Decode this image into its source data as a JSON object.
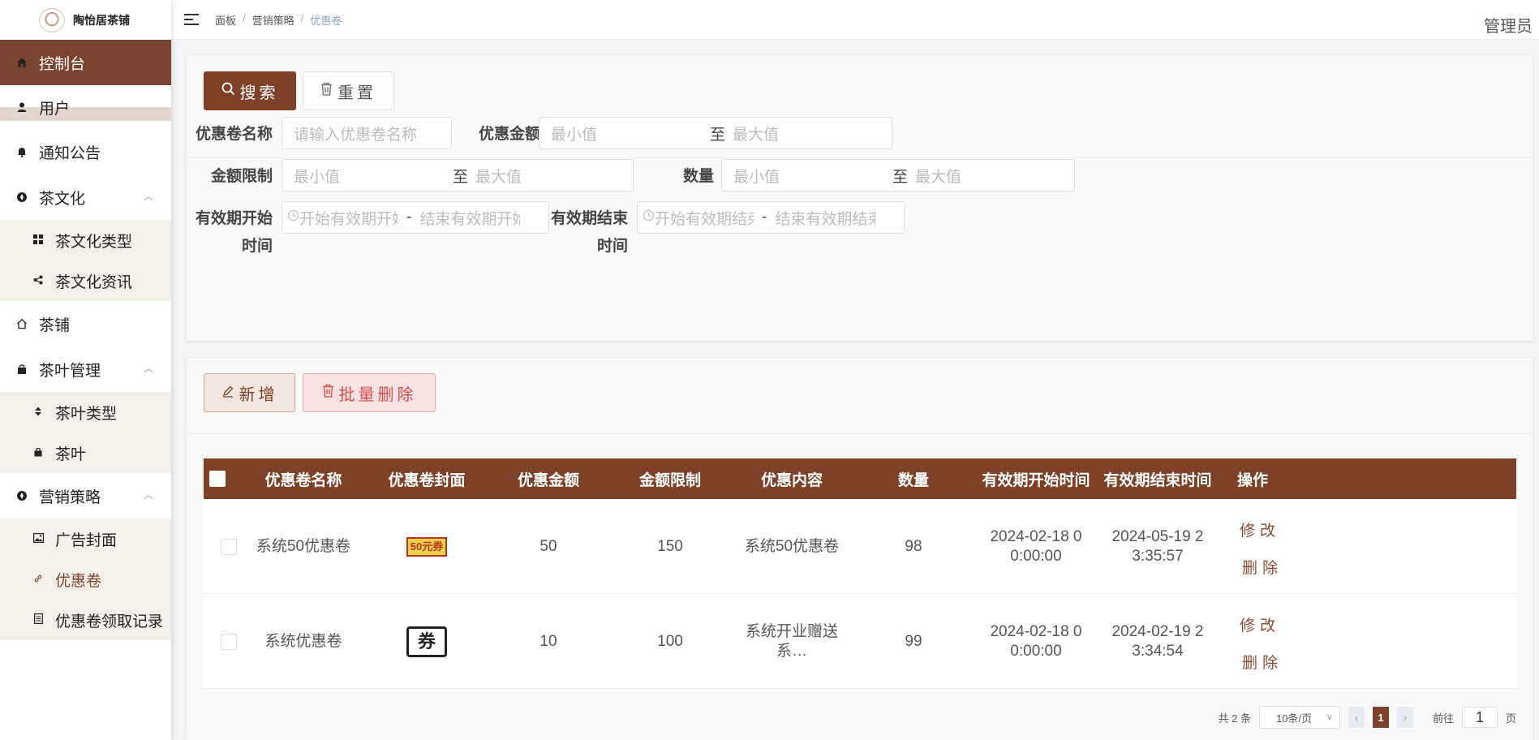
{
  "brand": {
    "name": "陶怡居茶铺"
  },
  "sidebar": {
    "items": [
      {
        "label": "控制台",
        "icon": "home-icon"
      },
      {
        "label": "用户",
        "icon": "user-icon"
      },
      {
        "label": "通知公告",
        "icon": "bell-icon"
      },
      {
        "label": "茶文化",
        "icon": "compass-icon",
        "children": [
          {
            "label": "茶文化类型",
            "icon": "grid-icon"
          },
          {
            "label": "茶文化资讯",
            "icon": "share-icon"
          }
        ]
      },
      {
        "label": "茶铺",
        "icon": "house-outline-icon"
      },
      {
        "label": "茶叶管理",
        "icon": "bag-icon",
        "children": [
          {
            "label": "茶叶类型",
            "icon": "sort-icon"
          },
          {
            "label": "茶叶",
            "icon": "bag-icon"
          }
        ]
      },
      {
        "label": "营销策略",
        "icon": "compass-icon",
        "children": [
          {
            "label": "广告封面",
            "icon": "picture-icon"
          },
          {
            "label": "优惠卷",
            "icon": "link-icon"
          },
          {
            "label": "优惠卷领取记录",
            "icon": "document-icon"
          }
        ]
      }
    ]
  },
  "header": {
    "breadcrumb": [
      "面板",
      "营销策略",
      "优惠卷"
    ],
    "user": "管理员"
  },
  "search": {
    "search_label": "搜索",
    "reset_label": "重置",
    "fields": {
      "name_label": "优惠卷名称",
      "name_placeholder": "请输入优惠卷名称",
      "amount_label": "优惠金额",
      "limit_label": "金额限制",
      "quantity_label": "数量",
      "min_placeholder": "最小值",
      "max_placeholder": "最大值",
      "range_to": "至",
      "start_label_1": "有效期开始",
      "start_label_2": "时间",
      "end_label_1": "有效期结束",
      "end_label_2": "时间",
      "start_from_placeholder": "开始有效期开始时间",
      "start_to_placeholder": "结束有效期开始时间",
      "end_from_placeholder": "开始有效期结束时间",
      "end_to_placeholder": "结束有效期结束时间",
      "date_sep": "-"
    }
  },
  "actions": {
    "add_label": "新增",
    "batch_delete_label": "批量删除"
  },
  "table": {
    "columns": [
      "优惠卷名称",
      "优惠卷封面",
      "优惠金额",
      "金额限制",
      "优惠内容",
      "数量",
      "有效期开始时间",
      "有效期结束时间",
      "操作"
    ],
    "rows": [
      {
        "name": "系统50优惠卷",
        "cover": "50元券",
        "amount": "50",
        "limit": "150",
        "content": "系统50优惠卷",
        "quantity": "98",
        "start": "2024-02-18 00:00:00",
        "end": "2024-05-19 23:35:57",
        "edit": "修改",
        "delete": "删除"
      },
      {
        "name": "系统优惠卷",
        "cover": "券",
        "amount": "10",
        "limit": "100",
        "content": "系统开业赠送系…",
        "quantity": "99",
        "start": "2024-02-18 00:00:00",
        "end": "2024-02-19 23:34:54",
        "edit": "修改",
        "delete": "删除"
      }
    ]
  },
  "pagination": {
    "total": "共 2 条",
    "page_size": "10条/页",
    "current": "1",
    "goto_prefix": "前往",
    "goto_value": "1",
    "goto_suffix": "页"
  },
  "colors": {
    "primary": "#7d4128",
    "danger": "#d34b4b",
    "sidebar_active": "#7a4530"
  }
}
